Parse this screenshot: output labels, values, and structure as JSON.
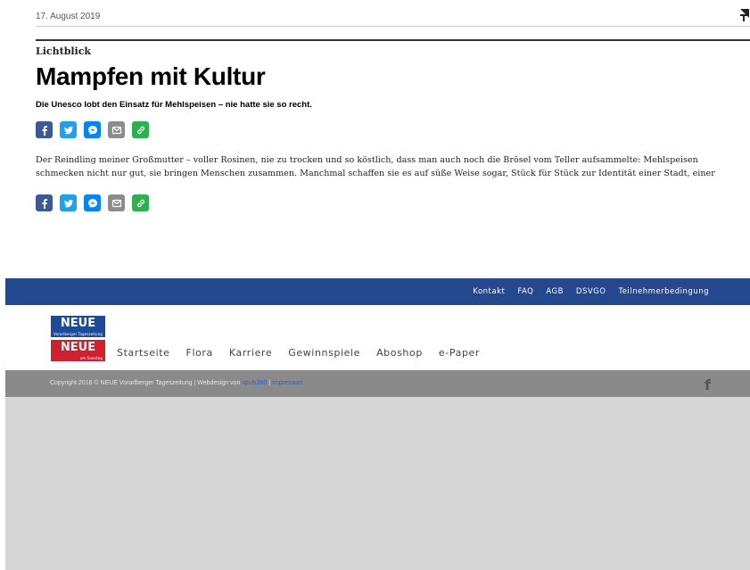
{
  "top": {
    "date": "17. August 2019",
    "icon": "pin-icon"
  },
  "article": {
    "kicker": "Lichtblick",
    "headline": "Mampfen mit Kultur",
    "subtitle": "Die Unesco lobt den Einsatz für Mehlspeisen – nie hatte sie so recht.",
    "body": "Der Reindling meiner Großmutter – voller Rosinen, nie zu trocken und so köstlich, dass man auch noch die Brösel vom Teller aufsammelte: Mehlspeisen schmecken nicht nur gut, sie bringen Menschen zusammen. Manchmal schaffen sie es auf süße Weise sogar, Stück für Stück zur Identität einer Stadt, einer"
  },
  "share": {
    "buttons": [
      {
        "icon": "facebook-icon",
        "color": "#3b5998"
      },
      {
        "icon": "twitter-icon",
        "color": "#1da1f2"
      },
      {
        "icon": "messenger-icon",
        "color": "#0084ff"
      },
      {
        "icon": "mail-icon",
        "color": "#8c8c8c"
      },
      {
        "icon": "link-icon",
        "color": "#2bb24c"
      }
    ]
  },
  "footer_nav": {
    "links": [
      "Kontakt",
      "FAQ",
      "AGB",
      "DSVGO",
      "Teilnehmerbedingung"
    ],
    "background": "#23488e"
  },
  "logo": {
    "top_word": "NEUE",
    "top_tag": "Vorarlberger Tageszeitung",
    "bottom_word": "NEUE",
    "bottom_tag": "am Sonntag",
    "top_color": "#1e4a9a",
    "bottom_color": "#d0202e"
  },
  "main_menu": {
    "items": [
      "Startseite",
      "Flora",
      "Karriere",
      "Gewinnspiele",
      "Aboshop",
      "e-Paper"
    ]
  },
  "copyright": {
    "text": "Copyright 2016 © NEUE Vorarlberger Tageszeitung | Webdesign von ",
    "agency": "vpuls360",
    "separator": " | ",
    "impressum": "Impressum",
    "social_icon": "facebook-icon",
    "social_label": "f"
  }
}
